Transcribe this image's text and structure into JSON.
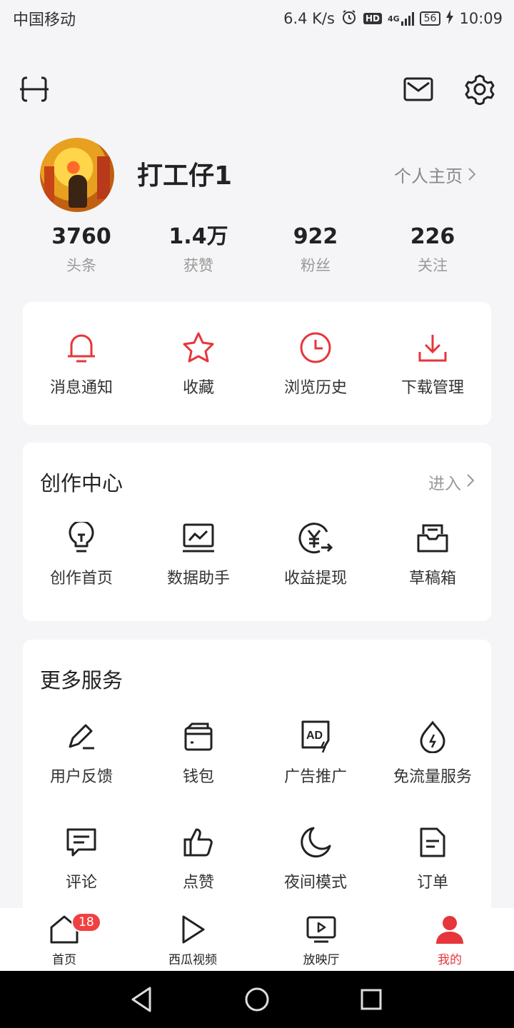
{
  "status_bar": {
    "carrier": "中国移动",
    "network_speed": "6.4 K/s",
    "hd": "HD",
    "signal_type": "4G",
    "battery": "56",
    "time": "10:09"
  },
  "profile": {
    "username": "打工仔1",
    "homepage_link": "个人主页"
  },
  "stats": [
    {
      "value": "3760",
      "label": "头条"
    },
    {
      "value": "1.4万",
      "label": "获赞"
    },
    {
      "value": "922",
      "label": "粉丝"
    },
    {
      "value": "226",
      "label": "关注"
    }
  ],
  "quick_actions": [
    {
      "label": "消息通知",
      "icon": "bell-icon"
    },
    {
      "label": "收藏",
      "icon": "star-icon"
    },
    {
      "label": "浏览历史",
      "icon": "clock-icon"
    },
    {
      "label": "下载管理",
      "icon": "download-icon"
    }
  ],
  "creation_center": {
    "title": "创作中心",
    "enter_label": "进入",
    "items": [
      {
        "label": "创作首页",
        "icon": "lightbulb-icon"
      },
      {
        "label": "数据助手",
        "icon": "chart-monitor-icon"
      },
      {
        "label": "收益提现",
        "icon": "yuan-withdraw-icon"
      },
      {
        "label": "草稿箱",
        "icon": "draft-box-icon"
      }
    ]
  },
  "more_services": {
    "title": "更多服务",
    "items": [
      {
        "label": "用户反馈",
        "icon": "pen-icon"
      },
      {
        "label": "钱包",
        "icon": "wallet-icon"
      },
      {
        "label": "广告推广",
        "icon": "ad-icon"
      },
      {
        "label": "免流量服务",
        "icon": "data-drop-icon"
      },
      {
        "label": "评论",
        "icon": "comment-icon"
      },
      {
        "label": "点赞",
        "icon": "thumbs-up-icon"
      },
      {
        "label": "夜间模式",
        "icon": "moon-icon"
      },
      {
        "label": "订单",
        "icon": "order-document-icon"
      }
    ]
  },
  "tab_bar": {
    "tabs": [
      {
        "label": "首页",
        "icon": "home-icon",
        "badge": "18"
      },
      {
        "label": "西瓜视频",
        "icon": "play-icon"
      },
      {
        "label": "放映厅",
        "icon": "tv-icon"
      },
      {
        "label": "我的",
        "icon": "person-icon",
        "active": true
      }
    ]
  },
  "colors": {
    "accent_red": "#e6363b",
    "badge_red": "#f04142",
    "background": "#f5f5f7"
  }
}
